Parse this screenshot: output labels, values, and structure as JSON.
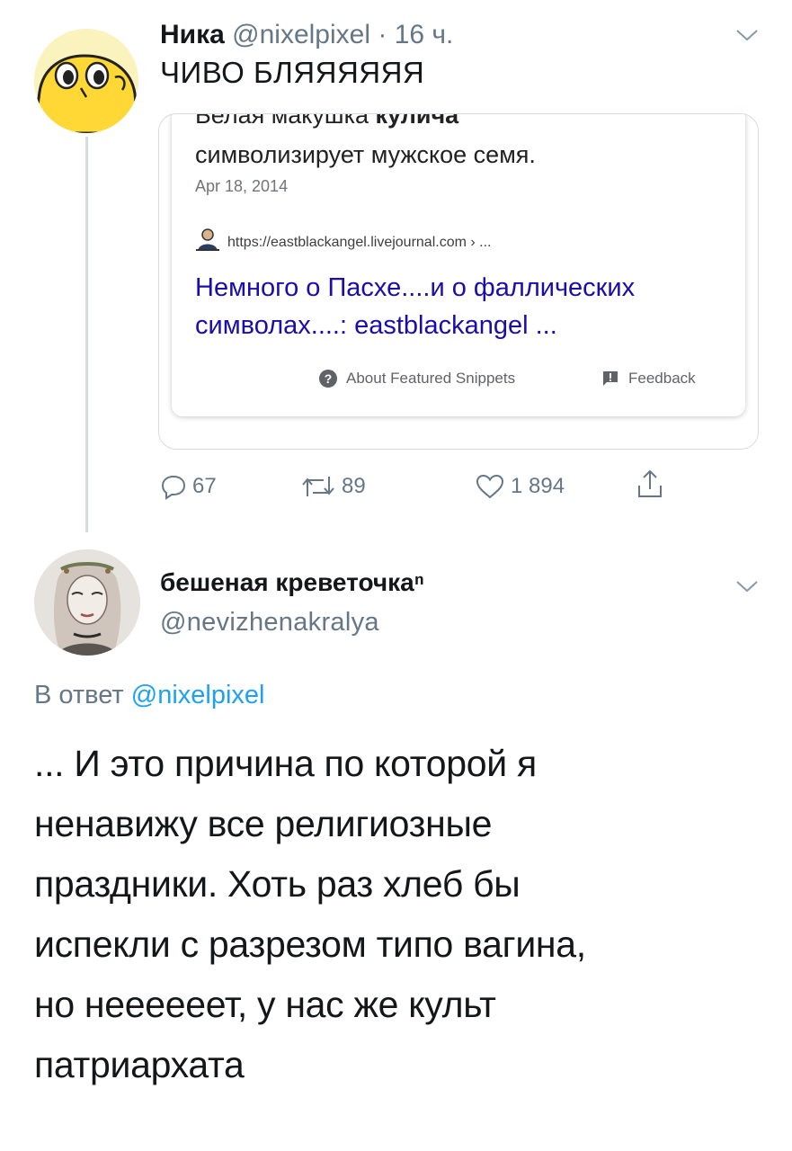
{
  "tweet1": {
    "author_name": "Ника",
    "author_handle": "@nixelpixel",
    "separator": " · ",
    "time": "16 ч.",
    "text": "ЧИВО БЛЯЯЯЯЯЯ",
    "quote": {
      "snippet_top_regular": "Белая макушка ",
      "snippet_top_bold": "кулича",
      "snippet_line2": "символизирует мужское семя.",
      "date": "Apr 18, 2014",
      "url": "https://eastblackangel.livejournal.com › ...",
      "link_line1": "Немного о Пасхе....и о фаллических",
      "link_line2": "символах....: eastblackangel ...",
      "about_label": "About Featured Snippets",
      "feedback_label": "Feedback"
    },
    "actions": {
      "replies": "67",
      "retweets": "89",
      "likes": "1 894"
    }
  },
  "tweet2": {
    "author_name": "бешеная креветочкаⁿ",
    "author_handle": "@nevizhenakralya",
    "reply_prefix": "В ответ ",
    "reply_mention": "@nixelpixel",
    "body_lines": [
      "... И это причина по которой я",
      "ненавижу все религиозные",
      "праздники. Хоть раз хлеб бы",
      "испекли с разрезом типо вагина,",
      "но неееееет, у нас же культ",
      "патриархата"
    ]
  },
  "colors": {
    "text": "#14171a",
    "secondary": "#657786",
    "link_blue": "#1da1f2",
    "google_link": "#1a0dab",
    "avatar1_bg": "#fbf3bd"
  },
  "icons": [
    "reply-icon",
    "retweet-icon",
    "like-icon",
    "share-icon",
    "chevron-down-icon",
    "help-icon",
    "feedback-icon",
    "person-icon"
  ]
}
